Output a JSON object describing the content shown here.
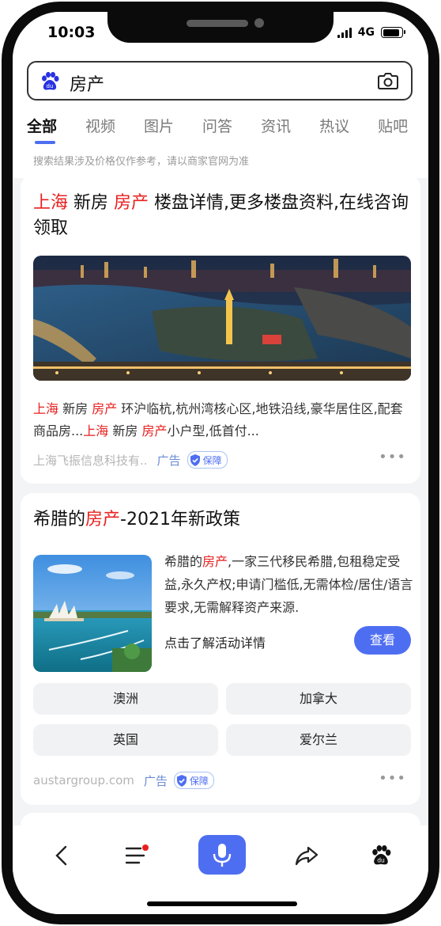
{
  "status_bar": {
    "time": "10:03",
    "network": "4G"
  },
  "search": {
    "query": "房产"
  },
  "tabs": [
    {
      "label": "全部"
    },
    {
      "label": "视频"
    },
    {
      "label": "图片"
    },
    {
      "label": "问答"
    },
    {
      "label": "资讯"
    },
    {
      "label": "热议"
    },
    {
      "label": "贴吧"
    }
  ],
  "disclaimer": "搜索结果涉及价格仅作参考，请以商家官网为准",
  "result1": {
    "title_city": "上海",
    "title_mid": " 新房 ",
    "title_kw": "房产",
    "title_rest": " 楼盘详情,更多楼盘资料,在线咨询领取",
    "desc_a": "上海",
    "desc_b": " 新房 ",
    "desc_c": "房产",
    "desc_d": " 环沪临杭,杭州湾核心区,地铁沿线,豪华居住区,配套商品房...",
    "desc_e": "上海",
    "desc_f": " 新房 ",
    "desc_g": "房产",
    "desc_h": "小户型,低首付...",
    "source": "上海飞振信息科技有..",
    "ad_label": "广告",
    "guarantee": "保障"
  },
  "result2": {
    "title_a": "希腊的",
    "title_kw": "房产",
    "title_b": "-2021年新政策",
    "text_a": "希腊的",
    "text_kw": "房产",
    "text_b": ",一家三代移民希腊,包租稳定受益,永久产权;申请门槛低,无需体检/居住/语言要求,无需解释资产来源.",
    "cta": "点击了解活动详情",
    "button": "查看",
    "chips": [
      "澳洲",
      "加拿大",
      "英国",
      "爱尔兰"
    ],
    "source": "austargroup.com",
    "ad_label": "广告",
    "guarantee": "保障"
  },
  "colors": {
    "accent": "#4e6ef2",
    "keyword": "#e8201f"
  },
  "toolbar": [
    "back-icon",
    "menu-icon",
    "microphone-icon",
    "share-icon",
    "baidu-paw-icon"
  ]
}
